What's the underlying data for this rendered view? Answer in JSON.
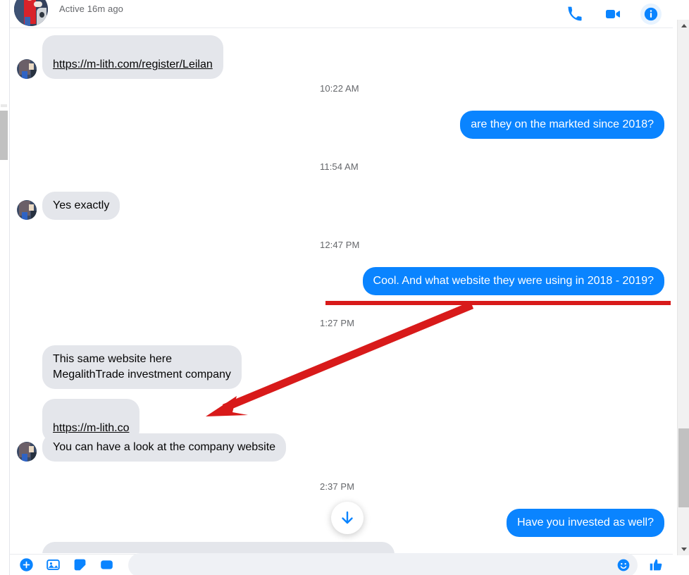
{
  "header": {
    "name_redacted": true,
    "status": "Active 16m ago",
    "actions": [
      {
        "name": "voice-call-button",
        "icon": "phone-icon",
        "label": "Voice call"
      },
      {
        "name": "video-call-button",
        "icon": "video-camera-icon",
        "label": "Video call"
      },
      {
        "name": "conversation-info-button",
        "icon": "info-icon",
        "label": "Conversation information"
      }
    ]
  },
  "colors": {
    "outgoing_bubble": "#0a84ff",
    "incoming_bubble": "#e4e6eb",
    "accent": "#0a84ff",
    "annotation_red": "#d81a1a",
    "timestamp_gray": "#65676b",
    "info_button_bg": "#e7f3ff"
  },
  "thread": {
    "messages": [
      {
        "id": "m1",
        "side": "them",
        "type": "link",
        "text": "https://m-lith.com/register/Leilan",
        "avatar": true
      },
      {
        "id": "t1",
        "side": "time",
        "text": "10:22 AM"
      },
      {
        "id": "m2",
        "side": "me",
        "type": "text",
        "text": "are they on the markted since 2018?"
      },
      {
        "id": "t2",
        "side": "time",
        "text": "11:54 AM"
      },
      {
        "id": "m3",
        "side": "them",
        "type": "text",
        "text": "Yes exactly",
        "avatar": true
      },
      {
        "id": "t3",
        "side": "time",
        "text": "12:47 PM"
      },
      {
        "id": "m4",
        "side": "me",
        "type": "text",
        "text": "Cool. And what website they were using in 2018 - 2019?"
      },
      {
        "id": "t4",
        "side": "time",
        "text": "1:27 PM"
      },
      {
        "id": "m5",
        "side": "them",
        "type": "text",
        "text": "This same website here\nMegalithTrade investment company",
        "avatar": false
      },
      {
        "id": "m6",
        "side": "them",
        "type": "link",
        "text": "https://m-lith.co",
        "avatar": false
      },
      {
        "id": "m7",
        "side": "them",
        "type": "text",
        "text": "You can have a look at the company website",
        "avatar": true
      },
      {
        "id": "t5",
        "side": "time",
        "text": "2:37 PM"
      },
      {
        "id": "m8",
        "side": "me",
        "type": "text",
        "text": "Have you invested as well?"
      }
    ],
    "scroll_to_bottom": {
      "name": "scroll-to-bottom-button",
      "icon": "arrow-down-icon"
    }
  },
  "annotations": {
    "underline": {
      "target": "Cool. And what website they were using in 2018 - 2019?",
      "color": "#d81a1a"
    },
    "arrow": {
      "points_to": "https://m-lith.co",
      "color": "#d81a1a"
    }
  },
  "composer": {
    "placeholder": "",
    "icons": [
      {
        "name": "add-attachment-button",
        "icon": "plus-circle-icon"
      },
      {
        "name": "attach-photo-button",
        "icon": "photo-icon"
      },
      {
        "name": "sticker-button",
        "icon": "sticker-icon"
      },
      {
        "name": "gif-button",
        "icon": "gif-icon"
      }
    ],
    "emoji": {
      "name": "emoji-button",
      "icon": "smiley-icon"
    },
    "like": {
      "name": "like-button",
      "icon": "thumbs-up-icon"
    }
  },
  "scrollbar": {
    "name": "thread-scrollbar",
    "up": "scroll-up-arrow",
    "down": "scroll-down-arrow"
  }
}
